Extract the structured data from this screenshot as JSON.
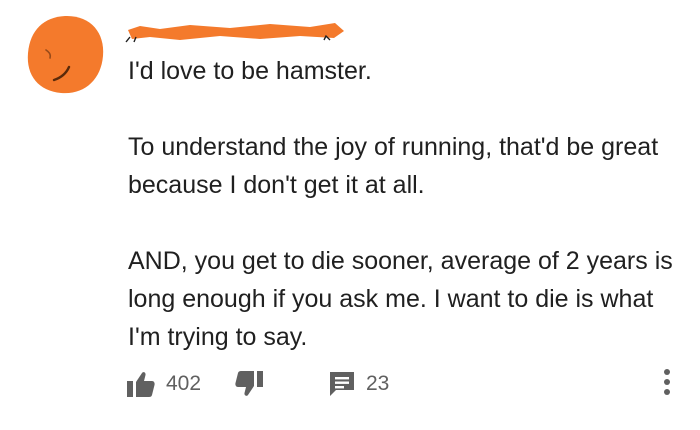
{
  "comment": {
    "author": "",
    "avatar_color": "#f47a2c",
    "redaction_color": "#f47a2c",
    "paragraphs": [
      "I'd love to be hamster.",
      "To understand the joy of running, that'd be great because I don't get it at all.",
      "AND, you get to die sooner, average of 2 years is long enough if you ask me. I want to die is what I'm trying to say."
    ]
  },
  "actions": {
    "like_icon": "thumbs-up-icon",
    "like_count": "402",
    "dislike_icon": "thumbs-down-icon",
    "reply_icon": "comment-icon",
    "reply_count": "23",
    "more_icon": "more-vertical-icon"
  }
}
